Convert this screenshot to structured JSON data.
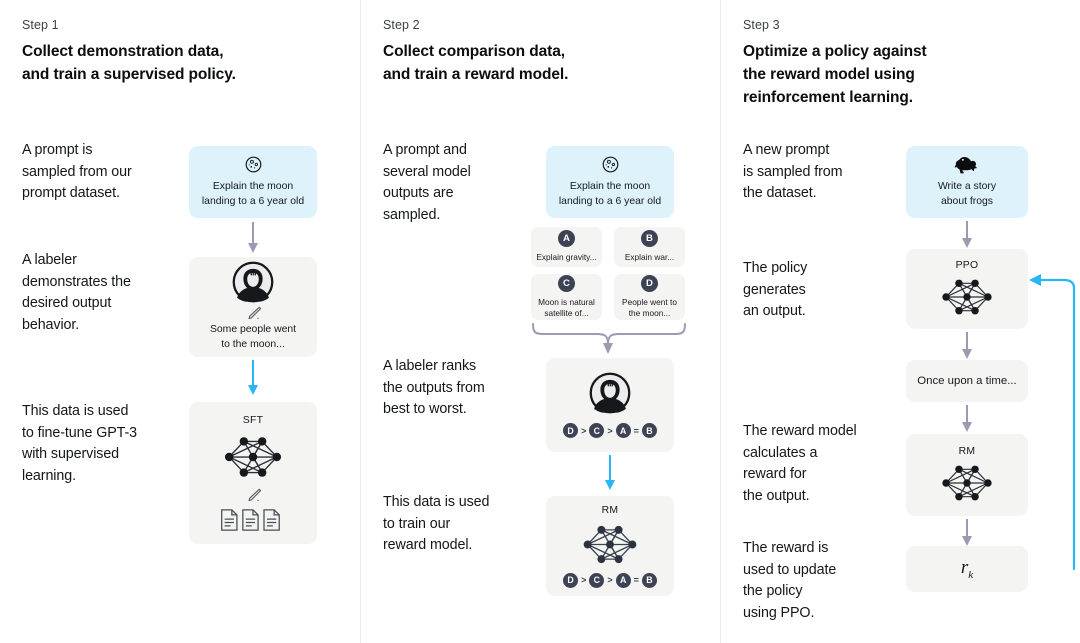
{
  "colors": {
    "prompt_card_bg": "#ddf2fb",
    "card_bg": "#f4f4f3",
    "grey_arrow": "#9a9bb0",
    "blue_arrow": "#29b6f6",
    "badge": "#3d4254",
    "divider": "#ededf0"
  },
  "steps": [
    {
      "label": "Step 1",
      "title": "Collect demonstration data,\nand train a supervised policy.",
      "paragraphs": [
        "A prompt is\nsampled from our\nprompt dataset.",
        "A labeler\ndemonstrates the\ndesired output\nbehavior.",
        "This data is used\nto fine-tune GPT-3\nwith supervised\nlearning."
      ],
      "nodes": [
        {
          "name": "prompt",
          "icon": "moon-icon",
          "text": "Explain the moon\nlanding to a 6 year old"
        },
        {
          "name": "labeler-demo",
          "icon": "labeler-icon",
          "sub_icon": "pencil-icon",
          "text": "Some people went\nto the moon..."
        },
        {
          "name": "sft-model",
          "head": "SFT",
          "icon": "neural-network-icon",
          "sub_icon": "pencil-icon",
          "extra_icon": "documents-icon"
        }
      ]
    },
    {
      "label": "Step 2",
      "title": "Collect comparison data,\nand train a reward model.",
      "paragraphs": [
        "A prompt and\nseveral model\noutputs are\nsampled.",
        "A labeler ranks\nthe outputs from\nbest to worst.",
        "This data is used\nto train our\nreward model."
      ],
      "nodes": [
        {
          "name": "prompt",
          "icon": "moon-icon",
          "text": "Explain the moon\nlanding to a 6 year old"
        },
        {
          "name": "labeler-ranking",
          "icon": "labeler-icon",
          "ranking": [
            "D",
            ">",
            "C",
            ">",
            "A",
            "=",
            "B"
          ]
        },
        {
          "name": "reward-model",
          "head": "RM",
          "icon": "neural-network-icon",
          "ranking": [
            "D",
            ">",
            "C",
            ">",
            "A",
            "=",
            "B"
          ]
        }
      ],
      "options": [
        {
          "badge": "A",
          "text": "Explain gravity..."
        },
        {
          "badge": "B",
          "text": "Explain war..."
        },
        {
          "badge": "C",
          "text": "Moon is natural\nsatellite of..."
        },
        {
          "badge": "D",
          "text": "People went to\nthe moon..."
        }
      ]
    },
    {
      "label": "Step 3",
      "title": "Optimize a policy against\nthe reward model using\nreinforcement learning.",
      "paragraphs": [
        "A new prompt\nis sampled from\nthe dataset.",
        "The policy\ngenerates\nan output.",
        "The reward model\ncalculates a\nreward for\nthe output.",
        "The reward is\nused to update\nthe policy\nusing PPO."
      ],
      "nodes": [
        {
          "name": "prompt",
          "icon": "frog-icon",
          "text": "Write a story\nabout frogs"
        },
        {
          "name": "ppo-policy",
          "head": "PPO",
          "icon": "neural-network-icon"
        },
        {
          "name": "generated-output",
          "text": "Once upon a time..."
        },
        {
          "name": "reward-model",
          "head": "RM",
          "icon": "neural-network-icon"
        },
        {
          "name": "reward-value",
          "formula": "r",
          "subscript": "k"
        }
      ]
    }
  ]
}
